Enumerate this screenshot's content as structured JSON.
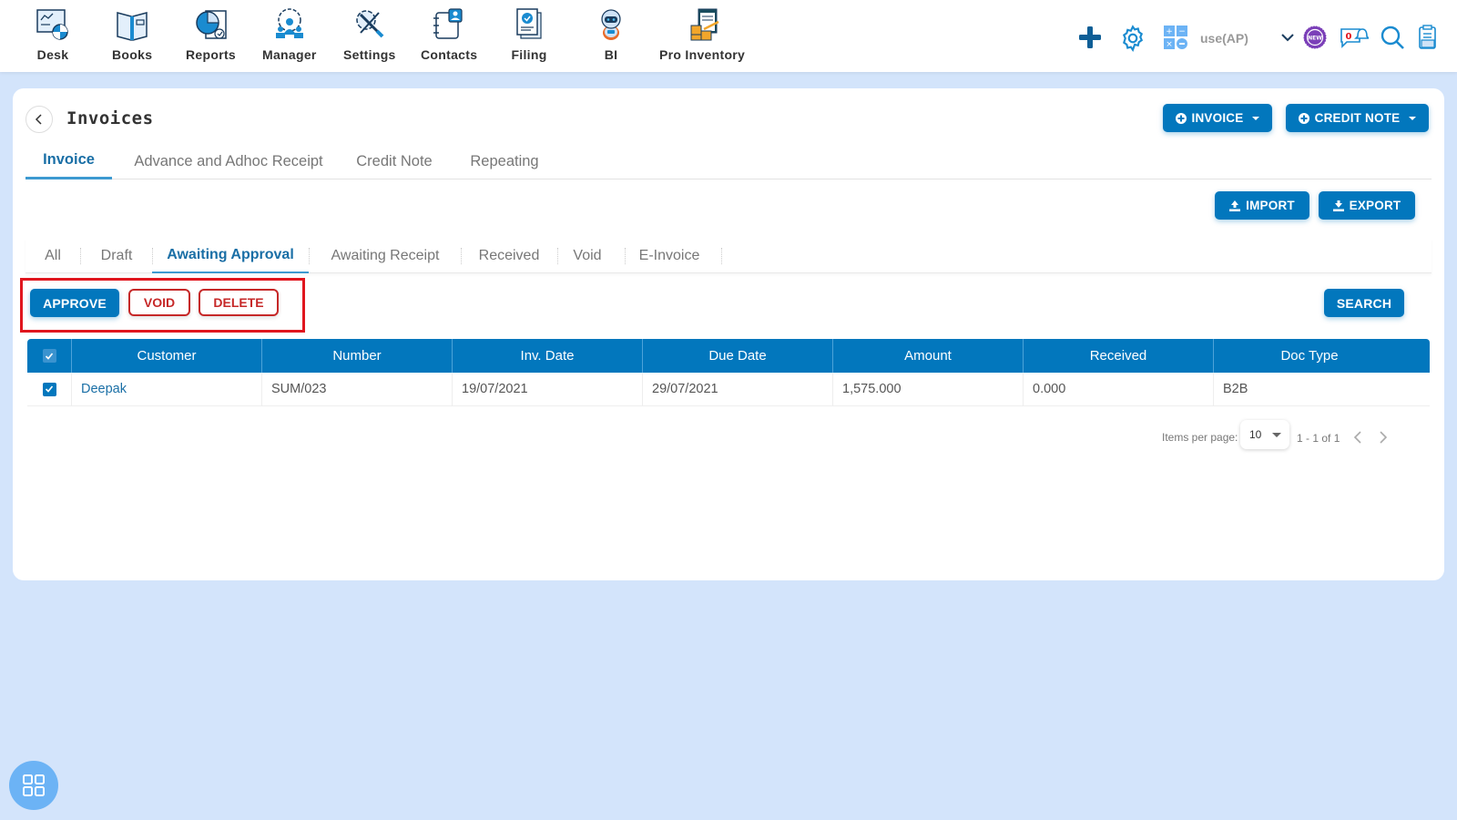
{
  "topnav": {
    "items": [
      {
        "label": "Desk",
        "icon": "desk-icon"
      },
      {
        "label": "Books",
        "icon": "books-icon"
      },
      {
        "label": "Reports",
        "icon": "reports-icon"
      },
      {
        "label": "Manager",
        "icon": "manager-icon"
      },
      {
        "label": "Settings",
        "icon": "settings-tools-icon"
      },
      {
        "label": "Contacts",
        "icon": "contacts-icon"
      },
      {
        "label": "Filing",
        "icon": "filing-icon"
      },
      {
        "label": "BI",
        "icon": "robot-icon"
      },
      {
        "label": "Pro Inventory",
        "icon": "inventory-icon"
      }
    ],
    "user_label": "use(AP)",
    "notification_count": "0",
    "new_badge": "NEW"
  },
  "page": {
    "title": "Invoices",
    "invoice_button": "INVOICE",
    "credit_note_button": "CREDIT NOTE",
    "main_tabs": [
      "Invoice",
      "Advance and Adhoc Receipt",
      "Credit Note",
      "Repeating"
    ],
    "active_main_tab": "Invoice",
    "import_button": "IMPORT",
    "export_button": "EXPORT",
    "sub_tabs": [
      "All",
      "Draft",
      "Awaiting Approval",
      "Awaiting Receipt",
      "Received",
      "Void",
      "E-Invoice"
    ],
    "active_sub_tab": "Awaiting Approval",
    "actions": {
      "approve": "APPROVE",
      "void": "VOID",
      "delete": "DELETE",
      "search": "SEARCH"
    }
  },
  "table": {
    "columns": [
      "Customer",
      "Number",
      "Inv. Date",
      "Due Date",
      "Amount",
      "Received",
      "Doc Type"
    ],
    "rows": [
      {
        "checked": true,
        "customer": "Deepak",
        "number": "SUM/023",
        "inv_date": "19/07/2021",
        "due_date": "29/07/2021",
        "amount": "1,575.000",
        "received": "0.000",
        "doc_type": "B2B"
      }
    ]
  },
  "pagination": {
    "items_per_page_label": "Items per page:",
    "items_per_page": "10",
    "range": "1 - 1 of 1"
  },
  "colors": {
    "primary": "#0277bd",
    "danger": "#c62828",
    "highlight": "#e0161e",
    "background": "#d3e4fb"
  }
}
